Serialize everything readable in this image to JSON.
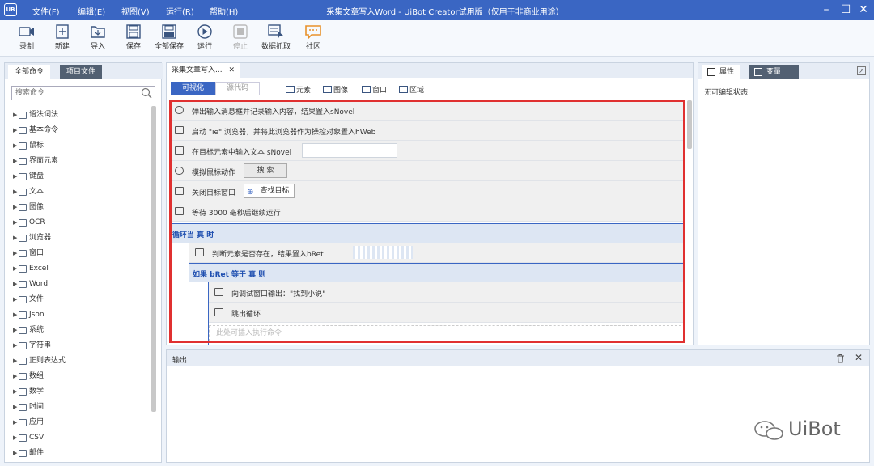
{
  "app": {
    "logo": "UB",
    "window_title": "采集文章写入Word - UiBot Creator试用版（仅用于非商业用途）",
    "menu": [
      "文件(F)",
      "编辑(E)",
      "视图(V)",
      "运行(R)",
      "帮助(H)"
    ],
    "window_controls": [
      "minimize-icon",
      "maximize-icon",
      "close-icon"
    ]
  },
  "toolbar": {
    "items": [
      {
        "label": "录制",
        "icon": "record-icon",
        "enabled": true
      },
      {
        "label": "新建",
        "icon": "new-file-icon",
        "enabled": true
      },
      {
        "label": "导入",
        "icon": "import-icon",
        "enabled": true
      },
      {
        "label": "保存",
        "icon": "save-icon",
        "enabled": true
      },
      {
        "label": "全部保存",
        "icon": "save-all-icon",
        "enabled": true
      },
      {
        "label": "运行",
        "icon": "run-icon",
        "enabled": true
      },
      {
        "label": "停止",
        "icon": "stop-icon",
        "enabled": false
      },
      {
        "label": "数据抓取",
        "icon": "data-scrape-icon",
        "enabled": true
      },
      {
        "label": "社区",
        "icon": "community-icon",
        "enabled": true
      }
    ]
  },
  "left_panel": {
    "tabs": [
      {
        "label": "全部命令",
        "active": true
      },
      {
        "label": "项目文件",
        "active": false
      }
    ],
    "search_placeholder": "搜索命令",
    "commands": [
      "语法词法",
      "基本命令",
      "鼠标",
      "界面元素",
      "键盘",
      "文本",
      "图像",
      "OCR",
      "浏览器",
      "窗口",
      "Excel",
      "Word",
      "文件",
      "Json",
      "系统",
      "字符串",
      "正则表达式",
      "数组",
      "数学",
      "时间",
      "应用",
      "CSV",
      "邮件"
    ]
  },
  "editor": {
    "tab_label": "采集文章写入...",
    "modes": {
      "visual": "可视化",
      "source": "源代码"
    },
    "pickers": [
      "元素",
      "图像",
      "窗口",
      "区域"
    ],
    "rows": {
      "r1": "弹出输入消息框并记录输入内容，结果置入sNovel",
      "r2": "启动 \"ie\" 浏览器，并将此浏览器作为操控对象置入hWeb",
      "r3": "在目标元素中输入文本 sNovel",
      "r4": "模拟鼠标动作",
      "r4_button": "搜 索",
      "r5": "关闭目标窗口",
      "r5_button": "查找目标",
      "r6": "等待 3000 毫秒后继续运行",
      "loop": "循环当 真 时",
      "r7": "判断元素是否存在，结果置入bRet",
      "if": "如果 bRet 等于 真 则",
      "r8": "向调试窗口输出：\"找到小说\"",
      "r9": "跳出循环",
      "insert_hint": "此处可插入执行命令"
    }
  },
  "right_panel": {
    "tabs": [
      {
        "label": "属性",
        "active": true
      },
      {
        "label": "变量",
        "active": false
      }
    ],
    "status": "无可编辑状态"
  },
  "output": {
    "title": "输出"
  },
  "watermark": "UiBot",
  "colors": {
    "accent": "#3a66c3",
    "highlight_frame": "#e03030",
    "dark_tab": "#526072"
  }
}
